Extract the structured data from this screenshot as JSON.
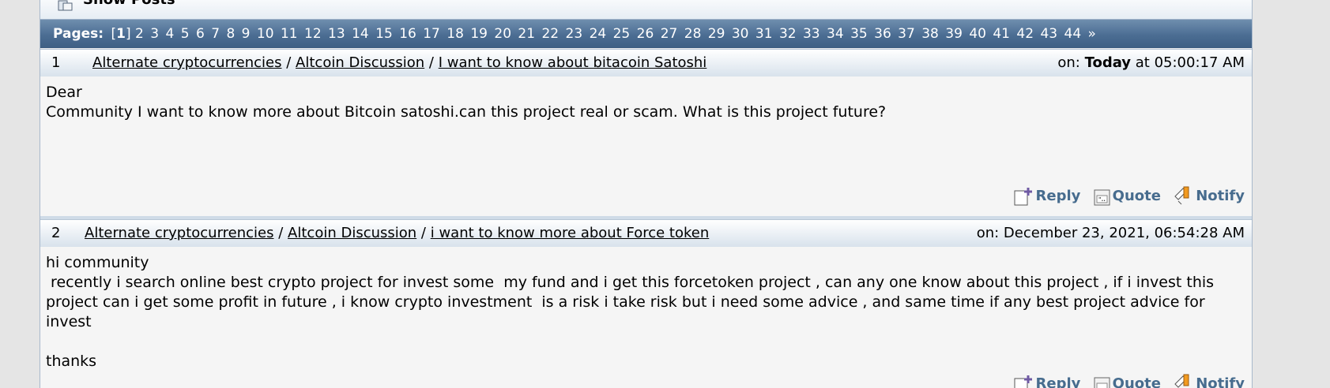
{
  "section_title": "Show Posts",
  "pagination": {
    "label": "Pages:",
    "current": "1",
    "pages": [
      "2",
      "3",
      "4",
      "5",
      "6",
      "7",
      "8",
      "9",
      "10",
      "11",
      "12",
      "13",
      "14",
      "15",
      "16",
      "17",
      "18",
      "19",
      "20",
      "21",
      "22",
      "23",
      "24",
      "25",
      "26",
      "27",
      "28",
      "29",
      "30",
      "31",
      "32",
      "33",
      "34",
      "35",
      "36",
      "37",
      "38",
      "39",
      "40",
      "41",
      "42",
      "43",
      "44"
    ],
    "next": "»"
  },
  "posts": [
    {
      "number": "1",
      "board": "Alternate cryptocurrencies",
      "subboard": "Altcoin Discussion",
      "topic": "I want to know about bitacoin Satoshi",
      "date_prefix": "on:",
      "date_bold": "Today",
      "date_rest": "at 05:00:17 AM",
      "body": [
        "Dear",
        "Community I want to know more about Bitcoin satoshi.can this project real or scam. What is this project future?"
      ]
    },
    {
      "number": "2",
      "board": "Alternate cryptocurrencies",
      "subboard": "Altcoin Discussion",
      "topic": "i want to know more about Force token",
      "date_prefix": "on:",
      "date_rest": "December 23, 2021, 06:54:28 AM",
      "body": [
        "hi community",
        " recently i search online best crypto project for invest some  my fund and i get this forcetoken project , can any one know about this project , if i invest this project can i get some profit in future , i know crypto investment  is a risk i take risk but i need some advice , and same time if any best project advice for invest",
        "",
        "thanks"
      ]
    }
  ],
  "actions": {
    "reply": "Reply",
    "quote": "Quote",
    "notify": "Notify"
  },
  "separator": "/"
}
